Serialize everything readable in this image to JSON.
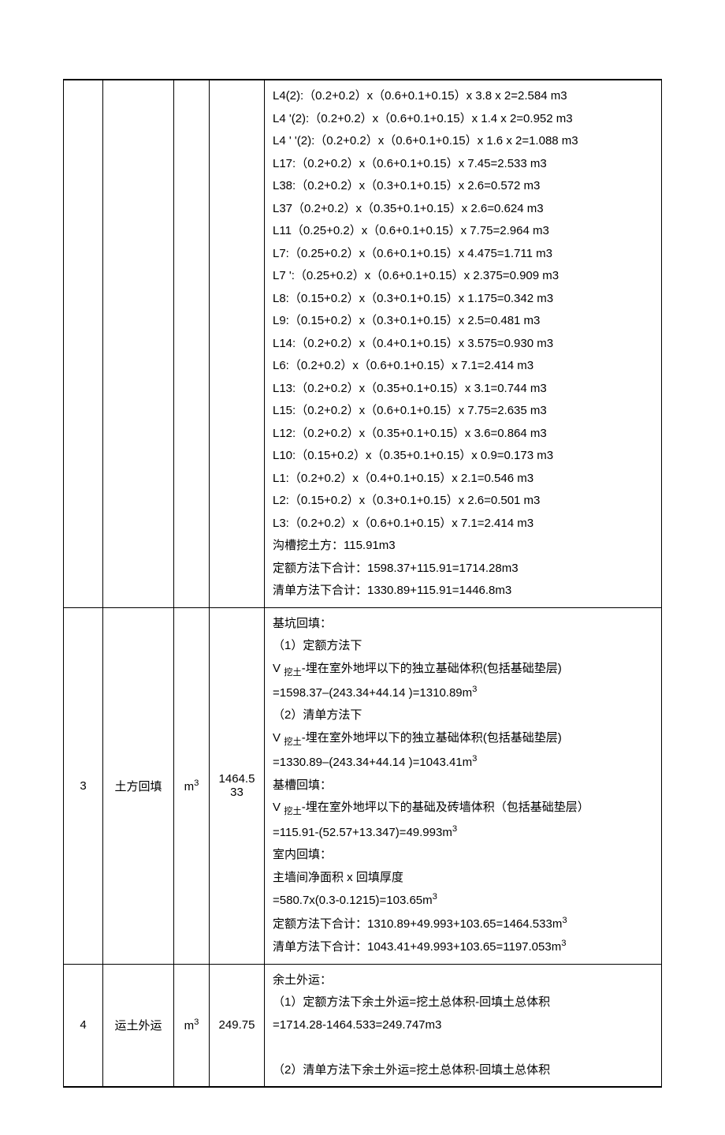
{
  "rows": [
    {
      "num": "",
      "name": "",
      "unit": "",
      "qty": "",
      "lines": [
        "L4(2):（0.2+0.2）x（0.6+0.1+0.15）x 3.8 x 2=2.584 m3",
        "L4 '(2):（0.2+0.2）x（0.6+0.1+0.15）x 1.4 x 2=0.952 m3",
        "L4 ' '(2):（0.2+0.2）x（0.6+0.1+0.15）x 1.6 x 2=1.088 m3",
        "L17:（0.2+0.2）x（0.6+0.1+0.15）x 7.45=2.533 m3",
        "L38:（0.2+0.2）x（0.3+0.1+0.15）x 2.6=0.572 m3",
        "L37（0.2+0.2）x（0.35+0.1+0.15）x 2.6=0.624 m3",
        "L11（0.25+0.2）x（0.6+0.1+0.15）x 7.75=2.964 m3",
        "L7:（0.25+0.2）x（0.6+0.1+0.15）x 4.475=1.711 m3",
        "L7 ':（0.25+0.2）x（0.6+0.1+0.15）x 2.375=0.909 m3",
        "L8:（0.15+0.2）x（0.3+0.1+0.15）x 1.175=0.342 m3",
        "L9:（0.15+0.2）x（0.3+0.1+0.15）x 2.5=0.481 m3",
        "L14:（0.2+0.2）x（0.4+0.1+0.15）x 3.575=0.930 m3",
        "L6:（0.2+0.2）x（0.6+0.1+0.15）x 7.1=2.414 m3",
        "L13:（0.2+0.2）x（0.35+0.1+0.15）x 3.1=0.744 m3",
        "L15:（0.2+0.2）x（0.6+0.1+0.15）x 7.75=2.635 m3",
        "L12:（0.2+0.2）x（0.35+0.1+0.15）x 3.6=0.864 m3",
        "L10:（0.15+0.2）x（0.35+0.1+0.15）x 0.9=0.173 m3",
        "L1:（0.2+0.2）x（0.4+0.1+0.15）x 2.1=0.546 m3",
        "L2:（0.15+0.2）x（0.3+0.1+0.15）x 2.6=0.501 m3",
        "L3:（0.2+0.2）x（0.6+0.1+0.15）x 7.1=2.414 m3",
        "沟槽挖土方：115.91m3",
        "定额方法下合计：1598.37+115.91=1714.28m3",
        "清单方法下合计：1330.89+115.91=1446.8m3"
      ]
    },
    {
      "num": "3",
      "name": "土方回填",
      "unit": "m<span class=\"super\">3</span>",
      "qty": "1464.5<br>33",
      "lines": [
        "基坑回填：",
        "（1）定额方法下",
        "V <span class=\"sub\">挖土</span>-埋在室外地坪以下的独立基础体积(包括基础垫层)",
        "=1598.37–(243.34+44.14 )=1310.89m<span class=\"super\">3</span>",
        "（2）清单方法下",
        "V <span class=\"sub\">挖土</span>-埋在室外地坪以下的独立基础体积(包括基础垫层)",
        "=1330.89–(243.34+44.14 )=1043.41m<span class=\"super\">3</span>",
        "基槽回填：",
        "V <span class=\"sub\">挖土</span>-埋在室外地坪以下的基础及砖墙体积（包括基础垫层）",
        "=115.91-(52.57+13.347)=49.993m<span class=\"super\">3</span>",
        "室内回填：",
        "主墙间净面积 x 回填厚度",
        "=580.7x(0.3-0.1215)=103.65m<span class=\"super\">3</span>",
        "定额方法下合计：1310.89+49.993+103.65=1464.533m<span class=\"super\">3</span>",
        "清单方法下合计：1043.41+49.993+103.65=1197.053m<span class=\"super\">3</span>"
      ]
    },
    {
      "num": "4",
      "name": "运土外运",
      "unit": "m<span class=\"super\">3</span>",
      "qty": "249.75",
      "lines": [
        "余土外运：",
        "（1）定额方法下余土外运=挖土总体积-回填土总体积",
        "=1714.28-1464.533=249.747m3",
        "&nbsp;",
        "（2）清单方法下余土外运=挖土总体积-回填土总体积"
      ]
    }
  ]
}
